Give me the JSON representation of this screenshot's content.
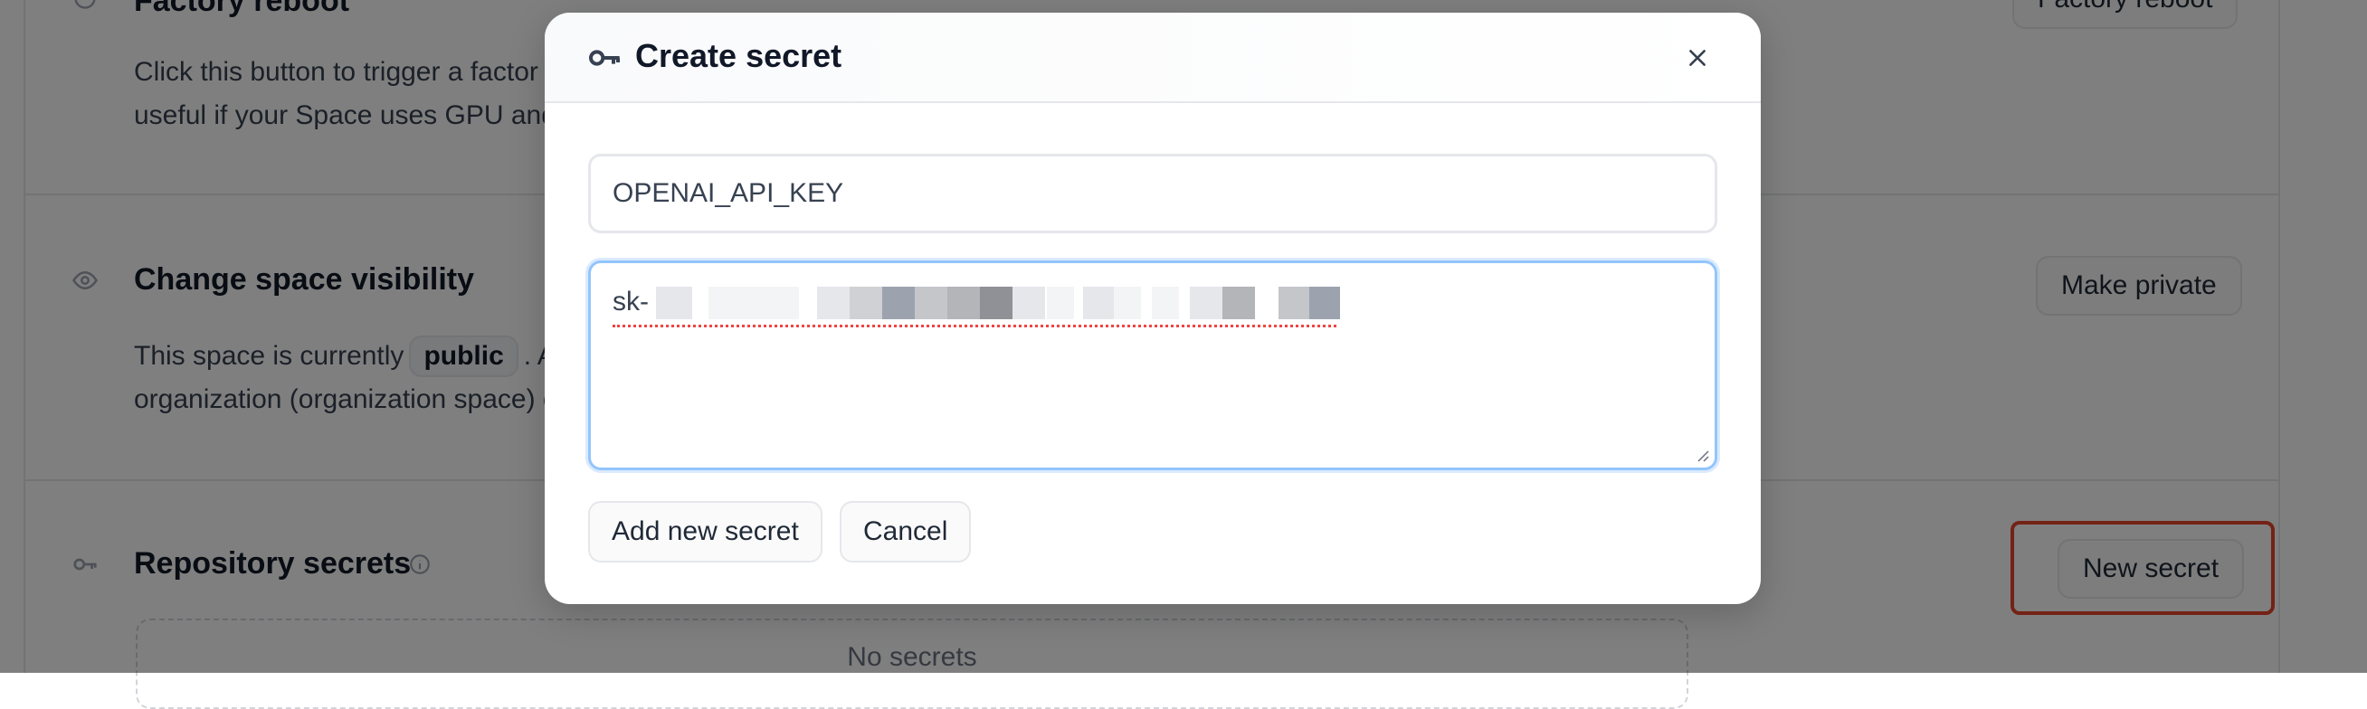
{
  "background": {
    "factory_reboot": {
      "title": "Factory reboot",
      "text_line1": "Click this button to trigger a factor",
      "text_line2": "useful if your Space uses GPU and",
      "button_label": "Factory reboot"
    },
    "visibility": {
      "title": "Change space visibility",
      "text_before": "This space is currently",
      "badge": "public",
      "text_after": ". A",
      "text_line2": "organization (organization space) c",
      "button_label": "Make private"
    },
    "secrets": {
      "title": "Repository secrets",
      "empty_text": "No secrets",
      "button_label": "New secret"
    }
  },
  "modal": {
    "title": "Create secret",
    "icon": "key-icon",
    "close_icon": "close-icon",
    "name_value": "OPENAI_API_KEY",
    "secret_value_visible": "sk-",
    "add_button": "Add new secret",
    "cancel_button": "Cancel"
  },
  "colors": {
    "highlight": "#e8452c",
    "focus_border": "#93c5fd",
    "overlay": "rgba(0,0,0,0.5)"
  }
}
